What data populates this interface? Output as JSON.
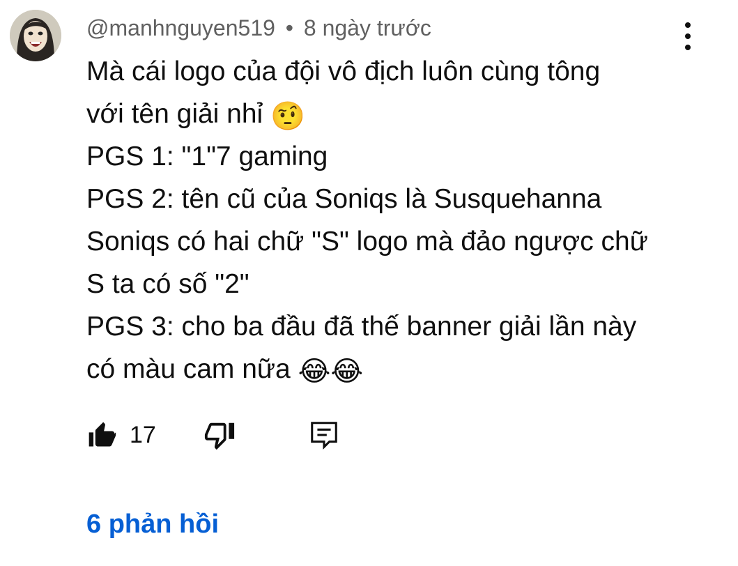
{
  "comment": {
    "author": "@manhnguyen519",
    "separator": "•",
    "time": "8 ngày trước",
    "lines": [
      {
        "text": "Mà cái logo của đội vô địch luôn cùng tông",
        "emoji": ""
      },
      {
        "text": "với tên giải nhỉ ",
        "emoji": "🤨"
      },
      {
        "text": "PGS 1: \"1\"7 gaming",
        "emoji": ""
      },
      {
        "text": "PGS 2: tên cũ của Soniqs là Susquehanna",
        "emoji": ""
      },
      {
        "text": "Soniqs có hai chữ \"S\" logo mà đảo ngược chữ",
        "emoji": ""
      },
      {
        "text": "S ta có số \"2\"",
        "emoji": ""
      },
      {
        "text": "PGS 3: cho ba đầu đã thế banner giải lần này",
        "emoji": ""
      },
      {
        "text": "có màu cam nữa ",
        "emoji": "😂😂"
      }
    ],
    "like_count": "17",
    "replies_label": "6 phản hồi"
  },
  "icons": {
    "avatar": "avatar-cartoon-face",
    "more": "more-vertical-icon",
    "like": "thumb-up-filled-icon",
    "dislike": "thumb-down-outline-icon",
    "reply": "comment-reply-icon"
  },
  "colors": {
    "text": "#0f0f0f",
    "meta": "#606060",
    "link": "#065fd4",
    "background": "#ffffff"
  }
}
